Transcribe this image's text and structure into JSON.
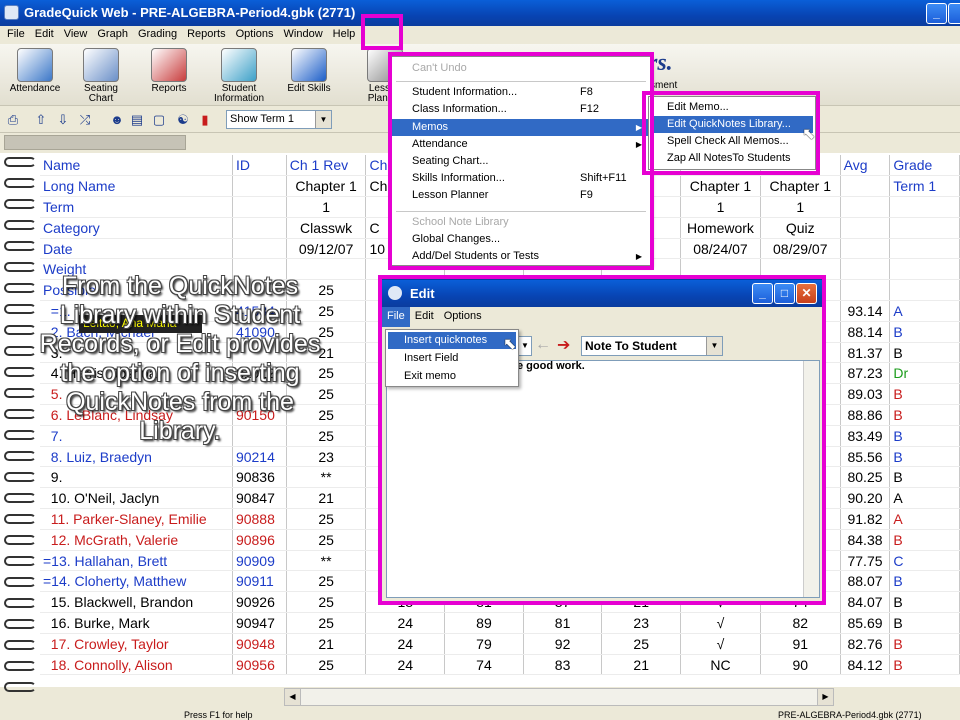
{
  "window": {
    "title": "GradeQuick Web - PRE-ALGEBRA-Period4.gbk (2771)"
  },
  "menubar": [
    "File",
    "Edit",
    "View",
    "Graph",
    "Grading",
    "Reports",
    "Options",
    "Window",
    "Help"
  ],
  "toolbar": [
    {
      "label1": "Attendance",
      "label2": "",
      "icon": "calendar-icon",
      "color": "#3c78c8"
    },
    {
      "label1": "Seating",
      "label2": "Chart",
      "icon": "desk-icon",
      "color": "#6a8fc8"
    },
    {
      "label1": "Reports",
      "label2": "",
      "icon": "report-icon",
      "color": "#c83c3c"
    },
    {
      "label1": "Student",
      "label2": "Information",
      "icon": "student-card-icon",
      "color": "#3ca0c8"
    },
    {
      "label1": "Edit Skills",
      "label2": "",
      "icon": "skills-cube-icon",
      "color": "#1c5ec8"
    },
    {
      "label1": "Lesson",
      "label2": "Planner",
      "icon": "planner-icon",
      "color": "#888888"
    }
  ],
  "toolbar_partial": "rs.",
  "toolbar_partial2": "sment",
  "toolbar2": {
    "term_select": "Show Term 1"
  },
  "grid": {
    "col_headers": [
      "Name",
      "ID",
      "Ch 1 Rev",
      "Ch",
      "",
      "",
      "",
      "",
      "z",
      "Avg",
      "Grade"
    ],
    "meta_rows": [
      {
        "label": "Long Name",
        "ch1rev": "Chapter 1",
        "ch": "Ch",
        "c7": "1",
        "c8": "Chapter 1",
        "c9": "Chapter 1",
        "grade": "Term 1"
      },
      {
        "label": "Term",
        "ch1rev": "1",
        "ch": "",
        "c7": "",
        "c8": "1",
        "c9": "1",
        "grade": ""
      },
      {
        "label": "Category",
        "ch1rev": "Classwk",
        "ch": "C",
        "c7": "wk",
        "c8": "Homework",
        "c9": "Quiz",
        "grade": ""
      },
      {
        "label": "Date",
        "ch1rev": "09/12/07",
        "ch": "10",
        "c7": "07",
        "c8": "08/24/07",
        "c9": "08/29/07",
        "grade": ""
      },
      {
        "label": "Weight",
        "ch1rev": "",
        "ch": "",
        "c7": "",
        "c8": "",
        "c9": "",
        "grade": ""
      },
      {
        "label": "Possible",
        "ch1rev": "25",
        "ch": "",
        "c7": "",
        "c8": "",
        "c9": "",
        "grade": ""
      }
    ],
    "students": [
      {
        "num": "=1.",
        "name": "",
        "id": "41534",
        "score": "25",
        "avg": "93.14",
        "grade": "A",
        "cls": "blue",
        "gcls": "blue"
      },
      {
        "num": "2.",
        "name": "Bach, Michael",
        "id": "41090",
        "score": "25",
        "avg": "88.14",
        "grade": "B",
        "cls": "blue",
        "gcls": "blue"
      },
      {
        "num": "3.",
        "name": "",
        "id": "",
        "score": "21",
        "avg": "81.37",
        "grade": "B",
        "cls": "",
        "gcls": ""
      },
      {
        "num": "4.",
        "name": "Harris, Joshua",
        "id": "81012",
        "score": "25",
        "avg": "87.23",
        "grade": "Dr",
        "cls": "",
        "gcls": "green"
      },
      {
        "num": "5.",
        "name": "",
        "id": "",
        "score": "25",
        "avg": "89.03",
        "grade": "B",
        "cls": "red",
        "gcls": "red"
      },
      {
        "num": "6.",
        "name": "LeBlanc, Lindsay",
        "id": "90150",
        "score": "25",
        "avg": "88.86",
        "grade": "B",
        "cls": "red",
        "gcls": "red"
      },
      {
        "num": "7.",
        "name": "",
        "id": "",
        "score": "25",
        "avg": "83.49",
        "grade": "B",
        "cls": "blue",
        "gcls": "blue"
      },
      {
        "num": "8.",
        "name": "Luiz, Braedyn",
        "id": "90214",
        "score": "23",
        "avg": "85.56",
        "grade": "B",
        "cls": "blue",
        "gcls": "blue"
      },
      {
        "num": "9.",
        "name": "",
        "id": "90836",
        "score": "**",
        "avg": "80.25",
        "grade": "B",
        "cls": "",
        "gcls": ""
      },
      {
        "num": "10.",
        "name": "O'Neil, Jaclyn",
        "id": "90847",
        "score": "21",
        "avg": "90.20",
        "grade": "A",
        "cls": "",
        "gcls": ""
      },
      {
        "num": "11.",
        "name": "Parker-Slaney, Emilie",
        "id": "90888",
        "score": "25",
        "avg": "91.82",
        "grade": "A",
        "cls": "red",
        "gcls": "red"
      },
      {
        "num": "12.",
        "name": "McGrath, Valerie",
        "id": "90896",
        "score": "25",
        "avg": "84.38",
        "grade": "B",
        "cls": "red",
        "gcls": "red"
      },
      {
        "num": "=13.",
        "name": "Hallahan, Brett",
        "id": "90909",
        "score": "**",
        "avg": "77.75",
        "grade": "C",
        "cls": "blue",
        "gcls": "blue"
      },
      {
        "num": "=14.",
        "name": "Cloherty, Matthew",
        "id": "90911",
        "score": "25",
        "avg": "88.07",
        "grade": "B",
        "cls": "blue",
        "gcls": "blue"
      },
      {
        "num": "15.",
        "name": "Blackwell, Brandon",
        "id": "90926",
        "score": "25",
        "c4": "18",
        "c5": "81",
        "c6": "87",
        "c7": "21",
        "c8": "√",
        "c9": "74",
        "avg": "84.07",
        "grade": "B",
        "cls": "",
        "gcls": ""
      },
      {
        "num": "16.",
        "name": "Burke, Mark",
        "id": "90947",
        "score": "25",
        "c4": "24",
        "c5": "89",
        "c6": "81",
        "c7": "23",
        "c8": "√",
        "c9": "82",
        "avg": "85.69",
        "grade": "B",
        "cls": "",
        "gcls": ""
      },
      {
        "num": "17.",
        "name": "Crowley, Taylor",
        "id": "90948",
        "score": "21",
        "c4": "24",
        "c5": "79",
        "c6": "92",
        "c7": "25",
        "c8": "√",
        "c9": "91",
        "avg": "82.76",
        "grade": "B",
        "cls": "red",
        "gcls": "red"
      },
      {
        "num": "18.",
        "name": "Connolly, Alison",
        "id": "90956",
        "score": "25",
        "c4": "24",
        "c5": "74",
        "c6": "83",
        "c7": "21",
        "c8": "NC",
        "c9": "90",
        "avg": "84.12",
        "grade": "B",
        "cls": "red",
        "gcls": "red"
      }
    ]
  },
  "name_chip": "Leitao, Ana Maria",
  "main_menu": {
    "cant_undo": "Can't Undo",
    "items": [
      {
        "label": "Student Information...",
        "shortcut": "F8"
      },
      {
        "label": "Class Information...",
        "shortcut": "F12"
      },
      {
        "label": "Memos",
        "shortcut": ""
      },
      {
        "label": "Attendance",
        "shortcut": ""
      },
      {
        "label": "Seating Chart...",
        "shortcut": ""
      },
      {
        "label": "Skills Information...",
        "shortcut": "Shift+F11"
      },
      {
        "label": "Lesson Planner",
        "shortcut": "F9"
      }
    ],
    "school_note": "School Note Library",
    "items2": [
      "Global Changes...",
      "Add/Del Students or Tests"
    ]
  },
  "submenu": [
    "Edit Memo...",
    "Edit QuickNotes Library...",
    "Spell Check All Memos...",
    "Zap All NotesTo Students"
  ],
  "edit_window": {
    "title": "Edit",
    "menu": [
      "File",
      "Edit",
      "Options"
    ],
    "note_select": "Note To Student",
    "body_text": "e good work."
  },
  "file_menu": [
    "Insert quicknotes",
    "Insert Field",
    "Exit memo"
  ],
  "caption": "From the QuickNotes Library within Student Records, or Edit provides the option of inserting QuickNotes from the Library.",
  "status": {
    "left": "Press F1 for help",
    "right": "PRE-ALGEBRA-Period4.gbk (2771)"
  }
}
